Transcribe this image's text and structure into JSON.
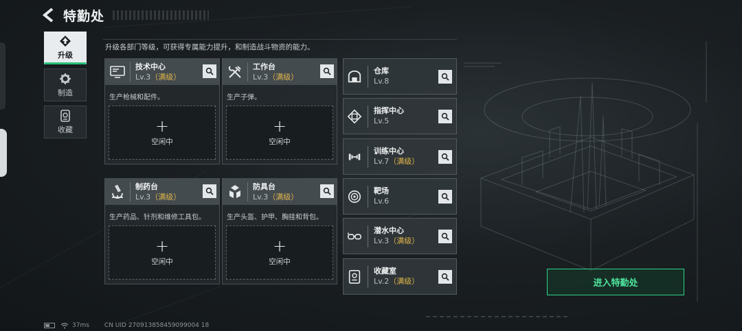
{
  "header": {
    "title": "特勤处"
  },
  "sidenav": [
    {
      "label": "升级",
      "icon": "upgrade-icon",
      "active": true
    },
    {
      "label": "制造",
      "icon": "gear-icon",
      "active": false
    },
    {
      "label": "收藏",
      "icon": "collection-icon",
      "active": false
    }
  ],
  "description": "升级各部门等级，可获得专属能力提升，和制造战斗物资的能力。",
  "cards": [
    {
      "name": "技术中心",
      "level": "Lv.3",
      "max": "（满级）",
      "desc": "生产枪械和配件。",
      "slot_plus": "+",
      "slot_status": "空闲中",
      "icon": "monitor-icon"
    },
    {
      "name": "工作台",
      "level": "Lv.3",
      "max": "（满级）",
      "desc": "生产子弹。",
      "slot_plus": "+",
      "slot_status": "空闲中",
      "icon": "tools-icon"
    },
    {
      "name": "制药台",
      "level": "Lv.3",
      "max": "（满级）",
      "desc": "生产药品、针剂和维修工具包。",
      "slot_plus": "+",
      "slot_status": "空闲中",
      "icon": "microscope-icon"
    },
    {
      "name": "防具台",
      "level": "Lv.3",
      "max": "（满级）",
      "desc": "生产头盔、护甲、胸挂和背包。",
      "slot_plus": "+",
      "slot_status": "空闲中",
      "icon": "armor-icon"
    }
  ],
  "facilities": [
    {
      "name": "仓库",
      "level": "Lv.8",
      "max": "",
      "icon": "warehouse-icon"
    },
    {
      "name": "指挥中心",
      "level": "Lv.5",
      "max": "",
      "icon": "chip-icon"
    },
    {
      "name": "训练中心",
      "level": "Lv.7",
      "max": "（满级）",
      "icon": "dumbbell-icon"
    },
    {
      "name": "靶场",
      "level": "Lv.6",
      "max": "",
      "icon": "target-icon"
    },
    {
      "name": "潜水中心",
      "level": "Lv.3",
      "max": "（满级）",
      "icon": "goggles-icon"
    },
    {
      "name": "收藏室",
      "level": "Lv.2",
      "max": "（满级）",
      "icon": "vault-icon"
    }
  ],
  "enter_button": "进入特勤处",
  "footer": {
    "ping": "37ms",
    "uid": "CN UID 270913858459099004 18"
  },
  "colors": {
    "accent_green": "#2fd48a",
    "max_level": "#e0b64a"
  }
}
